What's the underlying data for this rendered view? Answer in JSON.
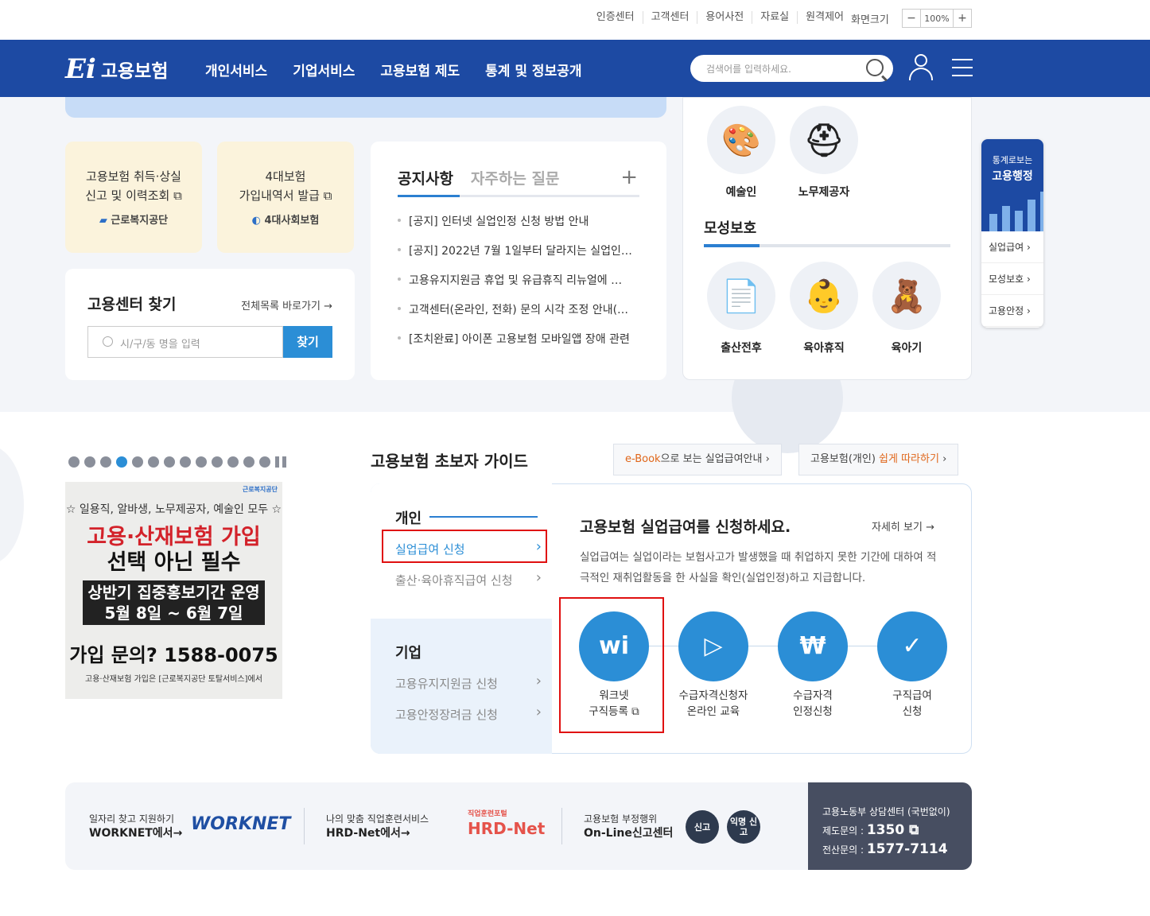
{
  "util": {
    "links": [
      "인증센터",
      "고객센터",
      "용어사전",
      "자료실",
      "원격제어"
    ],
    "zoom_label": "화면크기",
    "zoom_minus": "−",
    "zoom_value": "100%",
    "zoom_plus": "+"
  },
  "header": {
    "logo_text": "고용보험",
    "logo_mark": "Ei",
    "menu": [
      "개인서비스",
      "기업서비스",
      "고용보험 제도",
      "통계 및 정보공개"
    ],
    "search_placeholder": "검색어를 입력하세요."
  },
  "quick": [
    {
      "line1": "고용보험 취득·상실",
      "line2": "신고 및 이력조회 ⧉",
      "org": "근로복지공단"
    },
    {
      "line1": "4대보험",
      "line2": "가입내역서 발급 ⧉",
      "org": "4대사회보험"
    }
  ],
  "center_search": {
    "title": "고용센터 찾기",
    "all_link": "전체목록 바로가기 →",
    "placeholder": "시/구/동 명을 입력",
    "button": "찾기"
  },
  "notice": {
    "tab_active": "공지사항",
    "tab_other": "자주하는 질문",
    "plus": "+",
    "items": [
      "[공지] 인터넷 실업인정 신청 방법 안내",
      "[공지] 2022년 7월 1일부터 달라지는 실업인…",
      "고용유지지원금 휴업 및 유급휴직 리뉴얼에 …",
      "고객센터(온라인, 전화) 문의 시각 조정 안내(…",
      "[조치완료] 아이폰 고용보험 모바일앱 장애 관련"
    ]
  },
  "right_panel": {
    "top_items": [
      {
        "label": "예술인",
        "icon": "palette-icon"
      },
      {
        "label": "노무제공자",
        "icon": "helmet-icon"
      }
    ],
    "section_title": "모성보호",
    "items": [
      {
        "label": "출산전후",
        "icon": "document-coins-icon"
      },
      {
        "label": "육아휴직",
        "icon": "baby-icon"
      },
      {
        "label": "육아기",
        "icon": "teddy-bear-icon"
      }
    ]
  },
  "side_stat": {
    "line1": "통계로보는",
    "line2": "고용행정",
    "items": [
      "실업급여 ›",
      "모성보호 ›",
      "고용안정 ›"
    ]
  },
  "promo": {
    "org": "근로복지공단",
    "line1": "☆ 일용직, 알바생, 노무제공자, 예술인 모두 ☆",
    "line2": "고용·산재보험 가입",
    "line3": "선택 아닌 필수",
    "line4": "상반기 집중홍보기간 운영",
    "line5": "5월 8일 ~ 6월 7일",
    "line6": "가입 문의? 1588-0075",
    "line7": "고용·산재보험 가입은 [근로복지공단 토탈서비스]에서"
  },
  "guide": {
    "title": "고용보험 초보자 가이드",
    "btn1_em": "e-Book",
    "btn1_rest": "으로 보는 실업급여안내 ›",
    "btn2_pre": "고용보험(개인) ",
    "btn2_em": "쉽게 따라하기",
    "btn2_post": " ›",
    "personal_title": "개인",
    "personal_items": [
      "실업급여 신청",
      "출산·육아휴직급여 신청"
    ],
    "corp_title": "기업",
    "corp_items": [
      "고용유지지원금 신청",
      "고용안정장려금 신청"
    ],
    "main_title": "고용보험 실업급여를 신청하세요.",
    "more": "자세히 보기 →",
    "desc": "실업급여는 실업이라는 보험사고가 발생했을 때 취업하지 못한 기간에 대하여 적극적인 재취업활동을 한 사실을 확인(실업인정)하고 지급합니다.",
    "steps": [
      {
        "l1": "워크넷",
        "l2": "구직등록 ⧉",
        "icon": "worknet-icon",
        "glyph": "wi"
      },
      {
        "l1": "수급자격신청자",
        "l2": "온라인 교육",
        "icon": "monitor-play-icon",
        "glyph": "▷"
      },
      {
        "l1": "수급자격",
        "l2": "인정신청",
        "icon": "money-bag-icon",
        "glyph": "₩"
      },
      {
        "l1": "구직급여",
        "l2": "신청",
        "icon": "document-check-icon",
        "glyph": "✓"
      }
    ]
  },
  "footer": {
    "worknet_line1": "일자리 찾고 지원하기",
    "worknet_line2": "WORKNET에서→",
    "worknet_logo": "WORKNET",
    "hrd_line1": "나의 맞춤 직업훈련서비스",
    "hrd_line2": "HRD-Net에서→",
    "hrd_logo_small": "직업훈련포털",
    "hrd_logo": "HRD-Net",
    "report_line1": "고용보험 부정행위",
    "report_line2": "On-Line신고센터",
    "report_btn": "신고",
    "anon_btn": "익명 신고",
    "call_title": "고용노동부 상담센터 (국번없이)",
    "call_line1_label": "제도문의 : ",
    "call_line1_num": "1350 ⧉",
    "call_line2_label": "전산문의 : ",
    "call_line2_num": "1577-7114"
  }
}
